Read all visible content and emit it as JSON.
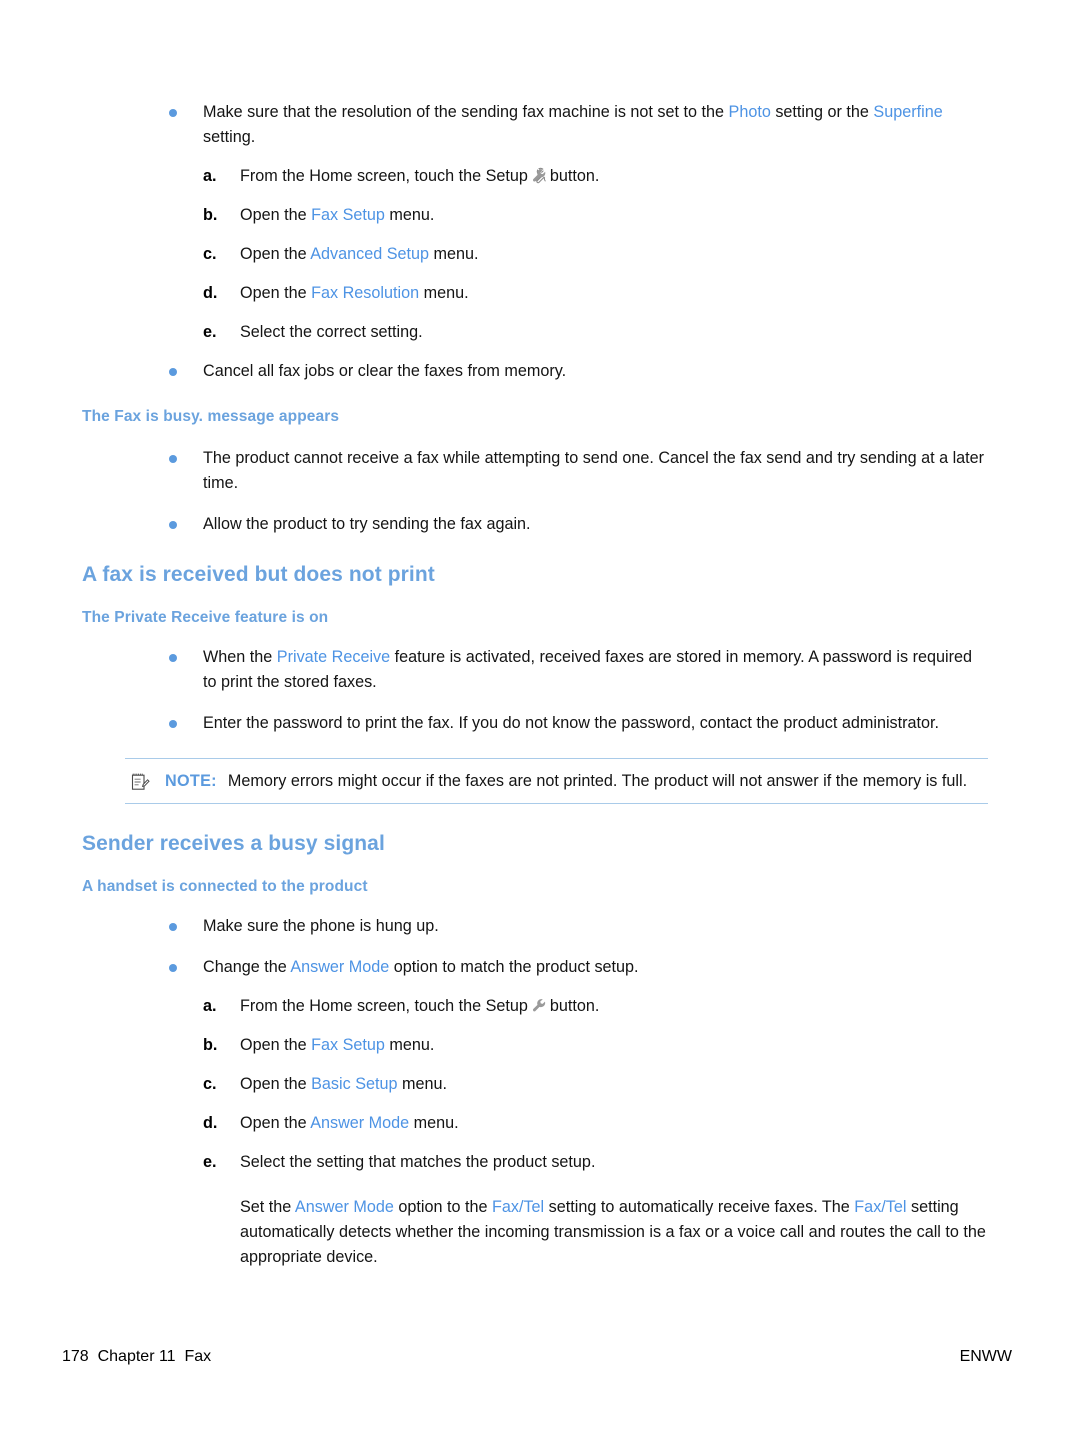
{
  "page": {
    "footer_page_number": "178",
    "footer_chapter": "Chapter 11",
    "footer_section": "Fax",
    "footer_right": "ENWW"
  },
  "icons": {
    "wrench": "wrench-icon",
    "note": "note-icon",
    "bullet": "bullet-dot"
  },
  "colors": {
    "heading_blue": "#6ba3de",
    "link_blue": "#4d93e4",
    "note_rule": "#a9cbe9",
    "bullet_blue": "#5b9ade"
  },
  "blocks": {
    "b1": {
      "t1": "Make sure that the resolution of the sending fax machine is not set to the ",
      "ui1": "Photo",
      "t2": " setting or the ",
      "ui2": "Superfine",
      "t3": " setting."
    },
    "steps1": {
      "a": {
        "marker": "a.",
        "t1": "From the Home screen, touch the Setup",
        "t2": "button."
      },
      "b": {
        "marker": "b.",
        "t1": "Open the ",
        "ui": "Fax Setup",
        "t2": " menu."
      },
      "c": {
        "marker": "c.",
        "t1": "Open the ",
        "ui": "Advanced Setup",
        "t2": " menu."
      },
      "d": {
        "marker": "d.",
        "t1": "Open the ",
        "ui": "Fax Resolution",
        "t2": " menu."
      },
      "e": {
        "marker": "e.",
        "t1": "Select the correct setting."
      }
    },
    "b2": {
      "t1": "Cancel all fax jobs or clear the faxes from memory."
    },
    "h_fax_busy": "The Fax is busy. message appears",
    "b3": {
      "t1": "The product cannot receive a fax while attempting to send one. Cancel the fax send and try sending at a later time."
    },
    "b4": {
      "t1": "Allow the product to try sending the fax again."
    },
    "h_fax_received": "A fax is received but does not print",
    "h_private_receive": "The Private Receive feature is on",
    "b5": {
      "t1": "When the ",
      "ui1": "Private Receive",
      "t2": " feature is activated, received faxes are stored in memory. A password is required to print the stored faxes."
    },
    "b6": {
      "t1": "Enter the password to print the fax. If you do not know the password, contact the product administrator."
    },
    "note": {
      "label": "NOTE:",
      "text": "Memory errors might occur if the faxes are not printed. The product will not answer if the memory is full."
    },
    "h_busy_signal": "Sender receives a busy signal",
    "h_handset": "A handset is connected to the product",
    "b7": {
      "t1": "Make sure the phone is hung up."
    },
    "b8": {
      "t1": "Change the ",
      "ui1": "Answer Mode",
      "t2": " option to match the product setup."
    },
    "steps2": {
      "a": {
        "marker": "a.",
        "t1": "From the Home screen, touch the Setup",
        "t2": "button."
      },
      "b": {
        "marker": "b.",
        "t1": "Open the ",
        "ui": "Fax Setup",
        "t2": " menu."
      },
      "c": {
        "marker": "c.",
        "t1": "Open the ",
        "ui": "Basic Setup",
        "t2": " menu."
      },
      "d": {
        "marker": "d.",
        "t1": "Open the ",
        "ui": "Answer Mode",
        "t2": " menu."
      },
      "e": {
        "marker": "e.",
        "t1": "Select the setting that matches the product setup."
      }
    },
    "final_para": {
      "t1": "Set the ",
      "ui1": "Answer Mode",
      "t2": " option to the ",
      "ui2": "Fax/Tel",
      "t3": " setting to automatically receive faxes. The ",
      "ui3": "Fax/Tel",
      "t4": " setting automatically detects whether the incoming transmission is a fax or a voice call and routes the call to the appropriate device."
    }
  }
}
